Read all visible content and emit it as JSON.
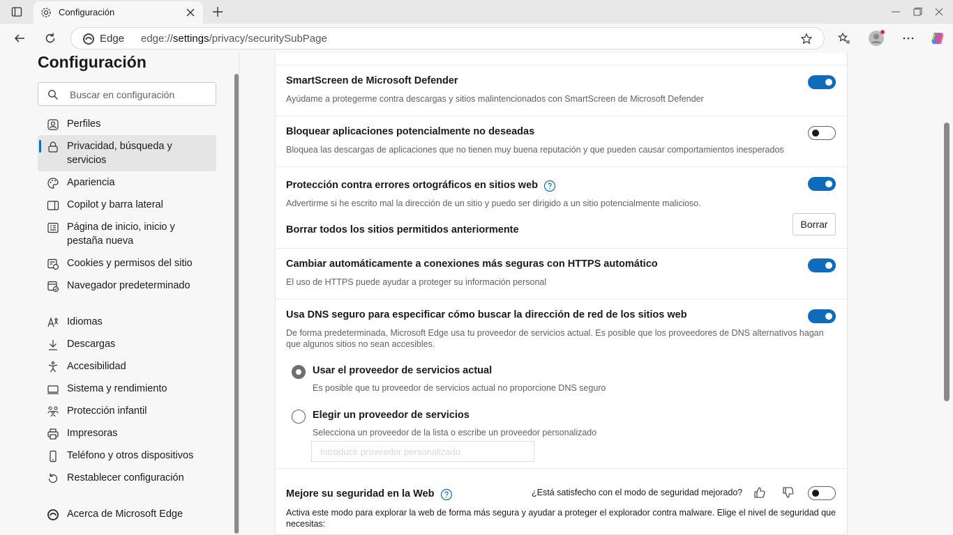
{
  "browser": {
    "tab_title": "Configuración",
    "site_label": "Edge",
    "url_prefix": "edge://",
    "url_strong": "settings",
    "url_suffix": "/privacy/securitySubPage"
  },
  "nav": {
    "title": "Configuración",
    "search_placeholder": "Buscar en configuración",
    "items": [
      {
        "label": "Perfiles",
        "icon": "profile-icon"
      },
      {
        "label": "Privacidad, búsqueda y servicios",
        "icon": "lock-icon",
        "active": true
      },
      {
        "label": "Apariencia",
        "icon": "palette-icon"
      },
      {
        "label": "Copilot y barra lateral",
        "icon": "sidebar-icon"
      },
      {
        "label": "Página de inicio, inicio y pestaña nueva",
        "icon": "home-page-icon"
      },
      {
        "label": "Cookies y permisos del sitio",
        "icon": "cookie-icon"
      },
      {
        "label": "Navegador predeterminado",
        "icon": "default-browser-icon"
      },
      {
        "label": "Idiomas",
        "icon": "language-icon"
      },
      {
        "label": "Descargas",
        "icon": "download-icon"
      },
      {
        "label": "Accesibilidad",
        "icon": "accessibility-icon"
      },
      {
        "label": "Sistema y rendimiento",
        "icon": "system-icon"
      },
      {
        "label": "Protección infantil",
        "icon": "family-icon"
      },
      {
        "label": "Impresoras",
        "icon": "printer-icon"
      },
      {
        "label": "Teléfono y otros dispositivos",
        "icon": "phone-icon"
      },
      {
        "label": "Restablecer configuración",
        "icon": "reset-icon"
      },
      {
        "label": "Acerca de Microsoft Edge",
        "icon": "edge-logo-icon"
      }
    ]
  },
  "settings": {
    "smartscreen": {
      "title": "SmartScreen de Microsoft Defender",
      "desc": "Ayúdame a protegerme contra descargas y sitios malintencionados con SmartScreen de Microsoft Defender",
      "enabled": true
    },
    "pua": {
      "title": "Bloquear aplicaciones potencialmente no deseadas",
      "desc": "Bloquea las descargas de aplicaciones que no tienen muy buena reputación y que pueden causar comportamientos inesperados",
      "enabled": false
    },
    "typo": {
      "title": "Protección contra errores ortográficos en sitios web",
      "desc": "Advertirme si he escrito mal la dirección de un sitio y puedo ser dirigido a un sitio potencialmente malicioso.",
      "enabled": true,
      "clear_title": "Borrar todos los sitios permitidos anteriormente",
      "clear_button": "Borrar"
    },
    "https": {
      "title": "Cambiar automáticamente a conexiones más seguras con HTTPS automático",
      "desc": "El uso de HTTPS puede ayudar a proteger su información personal",
      "enabled": true
    },
    "dns": {
      "title": "Usa DNS seguro para especificar cómo buscar la dirección de red de los sitios web",
      "desc": "De forma predeterminada, Microsoft Edge usa tu proveedor de servicios actual. Es posible que los proveedores de DNS alternativos hagan que algunos sitios no sean accesibles.",
      "enabled": true,
      "option1_label": "Usar el proveedor de servicios actual",
      "option1_desc": "Es posible que tu proveedor de servicios actual no proporcione DNS seguro",
      "option2_label": "Elegir un proveedor de servicios",
      "option2_desc": "Selecciona un proveedor de la lista o escribe un proveedor personalizado",
      "custom_placeholder": "Introducir proveedor personalizado",
      "selected_option": 1
    },
    "enhanced": {
      "title": "Mejore su seguridad en la Web",
      "feedback_question": "¿Está satisfecho con el modo de seguridad mejorado?",
      "desc": "Activa este modo para explorar la web de forma más segura y ayudar a proteger el explorador contra malware. Elige el nivel de seguridad que necesitas:",
      "enabled": false
    }
  },
  "colors": {
    "accent": "#0f6cbd"
  }
}
